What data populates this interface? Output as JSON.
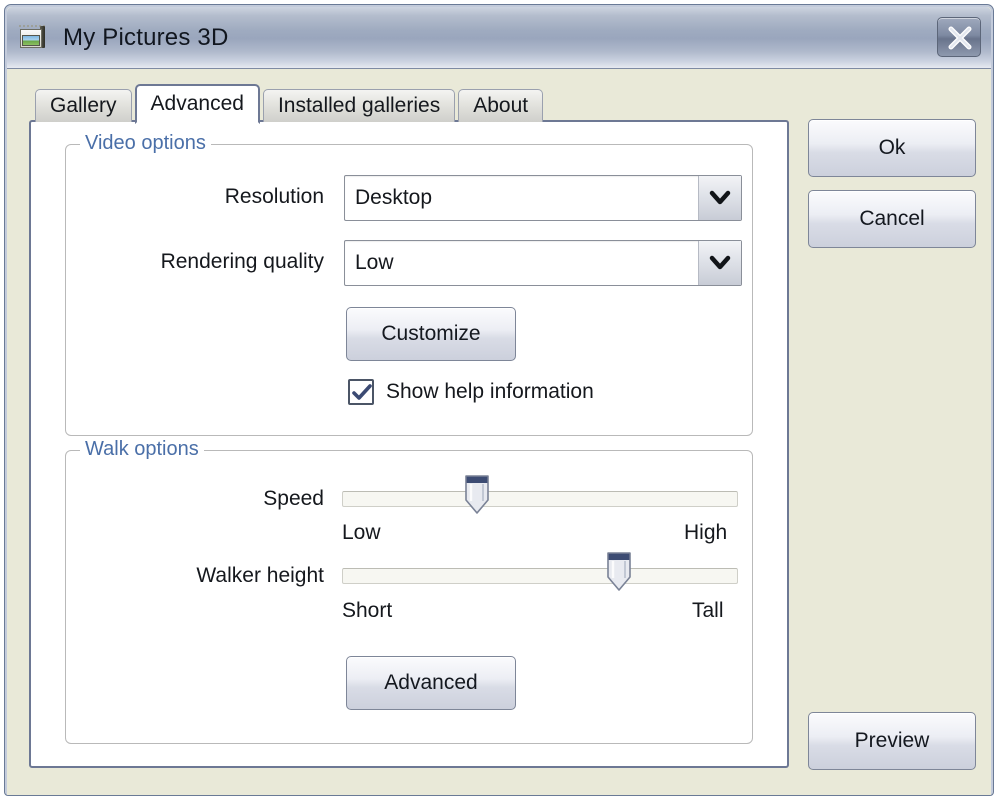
{
  "window": {
    "title": "My Pictures 3D",
    "icon": "picture-frame-icon",
    "close_label": "✕",
    "bg_color": "#e9e9d8",
    "titlebar_color": "#9aa6bd"
  },
  "tabs": [
    {
      "label": "Gallery",
      "active": false
    },
    {
      "label": "Advanced",
      "active": true
    },
    {
      "label": "Installed galleries",
      "active": false
    },
    {
      "label": "About",
      "active": false
    }
  ],
  "video_options": {
    "legend": "Video options",
    "legend_color": "#4a6fa8",
    "resolution": {
      "label": "Resolution",
      "value": "Desktop",
      "arrow_icon": "chevron-down-icon"
    },
    "rendering_quality": {
      "label": "Rendering quality",
      "value": "Low",
      "arrow_icon": "chevron-down-icon"
    },
    "customize_button": "Customize",
    "show_help": {
      "label": "Show help information",
      "checked": true,
      "check_icon": "checkmark-icon",
      "check_color": "#3b4a73"
    }
  },
  "walk_options": {
    "legend": "Walk options",
    "legend_color": "#4a6fa8",
    "speed": {
      "label": "Speed",
      "min_label": "Low",
      "max_label": "High",
      "value_percent": 34
    },
    "walker_height": {
      "label": "Walker height",
      "min_label": "Short",
      "max_label": "Tall",
      "value_percent": 70
    },
    "advanced_button": "Advanced"
  },
  "side_buttons": {
    "ok": "Ok",
    "cancel": "Cancel",
    "preview": "Preview"
  }
}
